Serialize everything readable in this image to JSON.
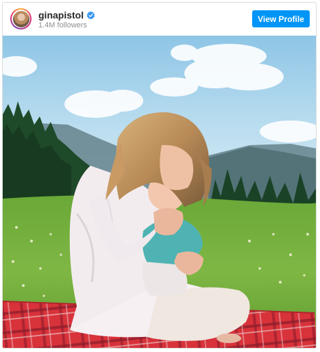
{
  "post": {
    "username": "ginapistol",
    "followers": "1.4M followers",
    "view_profile_label": "View Profile",
    "verified": true,
    "verified_color": "#3897f0",
    "button_color": "#0095f6",
    "photo_subject": "woman kissing baby on picnic blanket in mountain meadow"
  }
}
